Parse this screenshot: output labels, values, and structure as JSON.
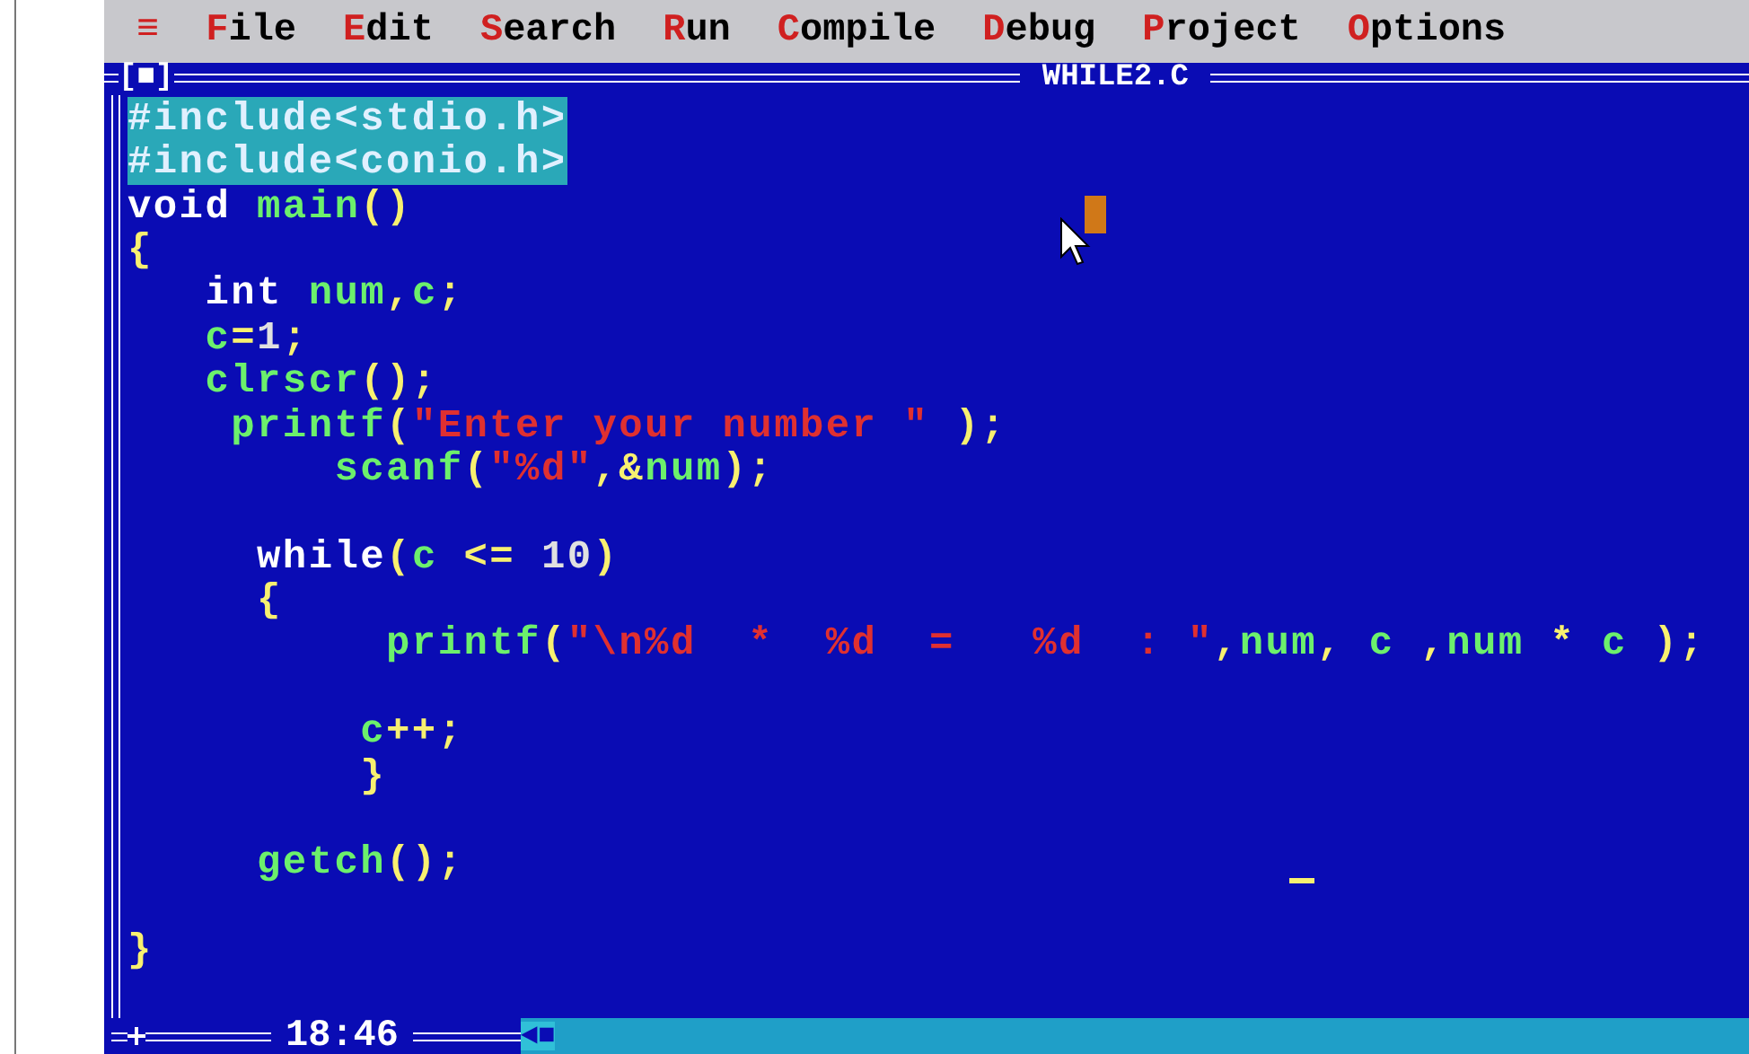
{
  "menu_bar": {
    "system_menu": "≡",
    "items": [
      "File",
      "Edit",
      "Search",
      "Run",
      "Compile",
      "Debug",
      "Project",
      "Options"
    ]
  },
  "editor": {
    "close_box": "[■]",
    "title": "WHILE2.C",
    "blocks": [
      [
        [
          {
            "kind": "preproc",
            "text": "#include<stdio.h>"
          }
        ],
        [
          {
            "kind": "preproc",
            "text": "#include<conio.h>"
          }
        ],
        [
          {
            "kind": "keyword",
            "text": "void"
          },
          {
            "kind": "ident",
            "text": " main"
          },
          {
            "kind": "punct",
            "text": "()"
          }
        ],
        [
          {
            "kind": "punct",
            "text": "{"
          }
        ],
        [
          {
            "kind": "keyword",
            "text": "   int"
          },
          {
            "kind": "ident",
            "text": " num"
          },
          {
            "kind": "punct",
            "text": ","
          },
          {
            "kind": "ident",
            "text": "c"
          },
          {
            "kind": "punct",
            "text": ";"
          }
        ],
        [
          {
            "kind": "ident",
            "text": "   c"
          },
          {
            "kind": "punct",
            "text": "="
          },
          {
            "kind": "number",
            "text": "1"
          },
          {
            "kind": "punct",
            "text": ";"
          }
        ],
        [
          {
            "kind": "ident",
            "text": "   clrscr"
          },
          {
            "kind": "punct",
            "text": "();"
          }
        ],
        [
          {
            "kind": "ident",
            "text": "    printf"
          },
          {
            "kind": "punct",
            "text": "("
          },
          {
            "kind": "string",
            "text": "\"Enter your number \""
          },
          {
            "kind": "punct",
            "text": " );"
          }
        ],
        [
          {
            "kind": "ident",
            "text": "        scanf"
          },
          {
            "kind": "punct",
            "text": "("
          },
          {
            "kind": "string",
            "text": "\"%d\""
          },
          {
            "kind": "punct",
            "text": ",&"
          },
          {
            "kind": "ident",
            "text": "num"
          },
          {
            "kind": "punct",
            "text": ");"
          }
        ]
      ],
      [
        [
          {
            "kind": "keyword",
            "text": "     while"
          },
          {
            "kind": "punct",
            "text": "("
          },
          {
            "kind": "ident",
            "text": "c"
          },
          {
            "kind": "punct",
            "text": " <= "
          },
          {
            "kind": "number",
            "text": "10"
          },
          {
            "kind": "punct",
            "text": ")"
          }
        ],
        [
          {
            "kind": "punct",
            "text": "     {"
          }
        ],
        [
          {
            "kind": "ident",
            "text": "          printf"
          },
          {
            "kind": "punct",
            "text": "("
          },
          {
            "kind": "string",
            "text": "\"\\n%d  *  %d  =   %d  : \""
          },
          {
            "kind": "punct",
            "text": ","
          },
          {
            "kind": "ident",
            "text": "num"
          },
          {
            "kind": "punct",
            "text": ", "
          },
          {
            "kind": "ident",
            "text": "c"
          },
          {
            "kind": "punct",
            "text": " ,"
          },
          {
            "kind": "ident",
            "text": "num"
          },
          {
            "kind": "punct",
            "text": " * "
          },
          {
            "kind": "ident",
            "text": "c"
          },
          {
            "kind": "punct",
            "text": " );"
          }
        ]
      ],
      [
        [
          {
            "kind": "ident",
            "text": "         c"
          },
          {
            "kind": "punct",
            "text": "++;"
          }
        ],
        [
          {
            "kind": "punct",
            "text": "         }"
          }
        ]
      ],
      [
        [
          {
            "kind": "ident",
            "text": "     getch"
          },
          {
            "kind": "punct",
            "text": "();"
          }
        ]
      ],
      [
        [
          {
            "kind": "punct",
            "text": "}"
          }
        ]
      ]
    ],
    "status": {
      "time": "18:46",
      "scroll_arrow": "◄■"
    }
  }
}
